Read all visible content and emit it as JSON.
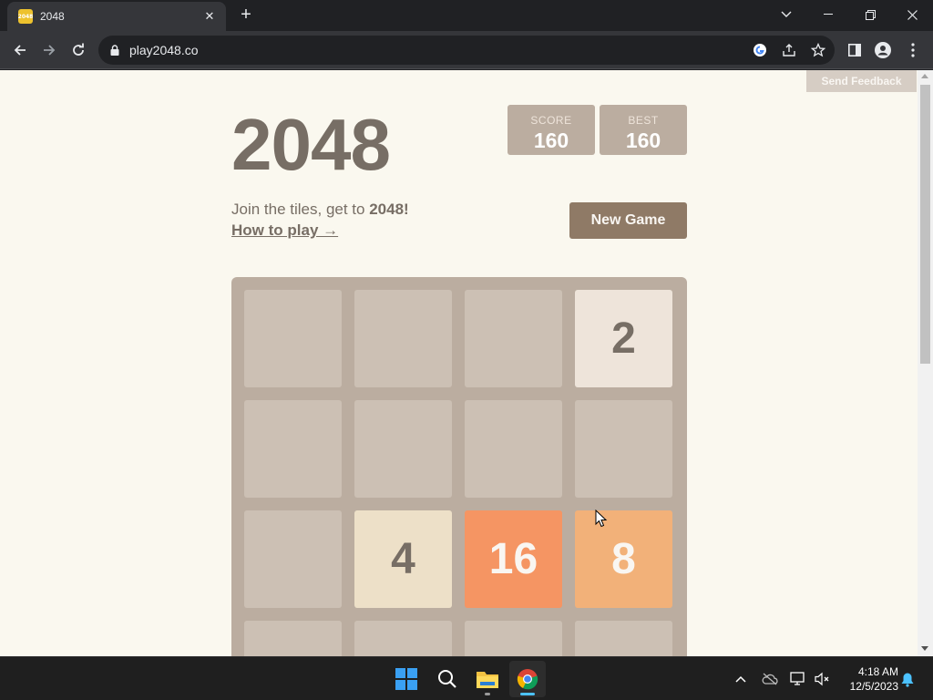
{
  "browser": {
    "tab": {
      "title": "2048",
      "favicon_text": "2048",
      "close_icon": "close-icon"
    },
    "new_tab_icon": "plus-icon",
    "url": "play2048.co"
  },
  "page": {
    "feedback_label": "Send Feedback",
    "title": "2048",
    "score": {
      "label": "SCORE",
      "value": "160"
    },
    "best": {
      "label": "BEST",
      "value": "160"
    },
    "intro_prefix": "Join the tiles, get to ",
    "intro_goal": "2048!",
    "how_to_play": "How to play →",
    "new_game_label": "New Game"
  },
  "board": {
    "rows": [
      [
        "",
        "",
        "",
        "2"
      ],
      [
        "",
        "",
        "",
        ""
      ],
      [
        "",
        "4",
        "16",
        "8"
      ],
      [
        "",
        "",
        "",
        ""
      ]
    ]
  },
  "tile_colors": {
    "2": {
      "bg": "#eee4da",
      "fg": "#776e65"
    },
    "4": {
      "bg": "#ede0c8",
      "fg": "#776e65"
    },
    "8": {
      "bg": "#f2b179",
      "fg": "#f9f6f2"
    },
    "16": {
      "bg": "#f59563",
      "fg": "#f9f6f2"
    }
  },
  "taskbar": {
    "apps": [
      "windows-start-icon",
      "search-icon",
      "file-explorer-icon",
      "chrome-icon"
    ],
    "time": "4:18 AM",
    "date": "12/5/2023"
  }
}
